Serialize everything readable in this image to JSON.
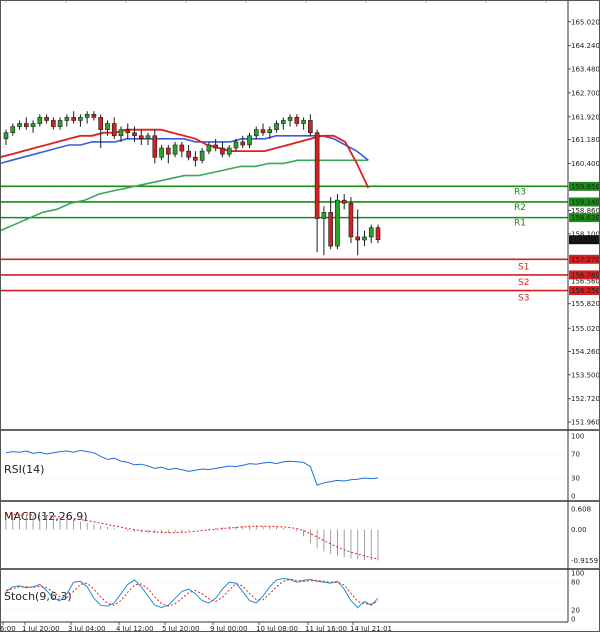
{
  "chart_data": [
    {
      "type": "candlestick",
      "title": "",
      "price_ticks": [
        165.02,
        164.24,
        163.48,
        162.7,
        161.92,
        161.18,
        160.4,
        158.86,
        158.1,
        155.82,
        155.02,
        154.26,
        153.5,
        152.72,
        151.96
      ],
      "x_labels": [
        "6:00",
        "1 Jul 20:00",
        "3 Jul 04:00",
        "4 Jul 12:00",
        "5 Jul 20:00",
        "9 Jul 00:00",
        "10 Jul 08:00",
        "11 Jul 16:00",
        "14 Jul 21:01"
      ],
      "current_price": "157.909",
      "ylim": [
        151.7,
        165.6
      ],
      "levels": [
        {
          "name": "R3",
          "value": 159.65,
          "label": "159.650",
          "color": "#1a8a1a"
        },
        {
          "name": "R2",
          "value": 159.14,
          "label": "159.140",
          "color": "#1a8a1a"
        },
        {
          "name": "R1",
          "value": 158.63,
          "label": "158.630",
          "color": "#1a8a1a"
        },
        {
          "name": "S1",
          "value": 157.27,
          "label": "157.270",
          "color": "#d42020"
        },
        {
          "name": "S2",
          "value": 156.76,
          "label": "156.760",
          "color": "#d42020"
        },
        {
          "name": "S3",
          "value": 156.25,
          "label": "156.250",
          "color": "#d42020"
        }
      ],
      "extra_tick": "156.560",
      "candles": [
        [
          161.2,
          161.5,
          161.0,
          161.4
        ],
        [
          161.4,
          161.7,
          161.3,
          161.6
        ],
        [
          161.6,
          161.8,
          161.5,
          161.7
        ],
        [
          161.7,
          161.9,
          161.5,
          161.6
        ],
        [
          161.6,
          161.8,
          161.4,
          161.7
        ],
        [
          161.7,
          162.0,
          161.6,
          161.9
        ],
        [
          161.9,
          162.0,
          161.7,
          161.8
        ],
        [
          161.8,
          161.9,
          161.5,
          161.6
        ],
        [
          161.6,
          161.9,
          161.5,
          161.8
        ],
        [
          161.8,
          162.0,
          161.6,
          161.9
        ],
        [
          161.9,
          162.1,
          161.7,
          161.8
        ],
        [
          161.8,
          162.0,
          161.6,
          161.9
        ],
        [
          161.9,
          162.1,
          161.7,
          162.0
        ],
        [
          162.0,
          162.1,
          161.8,
          161.9
        ],
        [
          161.9,
          162.0,
          160.9,
          161.5
        ],
        [
          161.5,
          161.8,
          161.3,
          161.7
        ],
        [
          161.7,
          161.9,
          161.2,
          161.3
        ],
        [
          161.3,
          161.6,
          161.1,
          161.5
        ],
        [
          161.5,
          161.7,
          161.2,
          161.4
        ],
        [
          161.4,
          161.6,
          161.1,
          161.3
        ],
        [
          161.3,
          161.5,
          161.0,
          161.2
        ],
        [
          161.2,
          161.4,
          161.0,
          161.3
        ],
        [
          161.3,
          161.5,
          160.4,
          160.6
        ],
        [
          160.6,
          161.0,
          160.5,
          160.9
        ],
        [
          160.9,
          161.0,
          160.4,
          160.7
        ],
        [
          160.7,
          161.1,
          160.6,
          161.0
        ],
        [
          161.0,
          161.1,
          160.6,
          160.8
        ],
        [
          160.8,
          161.0,
          160.5,
          160.6
        ],
        [
          160.6,
          160.8,
          160.3,
          160.5
        ],
        [
          160.5,
          160.9,
          160.4,
          160.8
        ],
        [
          160.8,
          161.1,
          160.7,
          161.0
        ],
        [
          161.0,
          161.2,
          160.8,
          160.9
        ],
        [
          160.9,
          161.1,
          160.6,
          160.7
        ],
        [
          160.7,
          161.0,
          160.6,
          160.9
        ],
        [
          160.9,
          161.2,
          160.8,
          161.1
        ],
        [
          161.1,
          161.3,
          160.9,
          161.0
        ],
        [
          161.0,
          161.4,
          160.9,
          161.3
        ],
        [
          161.3,
          161.6,
          161.2,
          161.5
        ],
        [
          161.5,
          161.7,
          161.3,
          161.4
        ],
        [
          161.4,
          161.6,
          161.2,
          161.5
        ],
        [
          161.5,
          161.8,
          161.4,
          161.7
        ],
        [
          161.7,
          161.9,
          161.5,
          161.8
        ],
        [
          161.8,
          162.0,
          161.6,
          161.9
        ],
        [
          161.9,
          162.0,
          161.6,
          161.7
        ],
        [
          161.7,
          161.9,
          161.5,
          161.8
        ],
        [
          161.8,
          162.0,
          161.3,
          161.4
        ],
        [
          161.4,
          161.5,
          157.5,
          158.6
        ],
        [
          158.6,
          159.0,
          157.4,
          158.8
        ],
        [
          158.8,
          159.3,
          157.6,
          157.7
        ],
        [
          157.7,
          159.4,
          157.6,
          159.2
        ],
        [
          159.2,
          159.4,
          158.9,
          159.1
        ],
        [
          159.1,
          159.3,
          157.8,
          158.0
        ],
        [
          158.0,
          158.9,
          157.4,
          157.9
        ],
        [
          157.9,
          158.2,
          157.7,
          158.0
        ],
        [
          158.0,
          158.4,
          157.8,
          158.3
        ],
        [
          158.3,
          158.4,
          157.8,
          157.909
        ]
      ],
      "ma_red": [
        160.6,
        160.7,
        160.8,
        160.9,
        161.0,
        161.1,
        161.2,
        161.3,
        161.3,
        161.4,
        161.4,
        161.5,
        161.5,
        161.5,
        161.5,
        161.4,
        161.3,
        161.2,
        161.0,
        160.9,
        160.8,
        160.8,
        160.8,
        160.8,
        160.9,
        161.0,
        161.1,
        161.2,
        161.3,
        161.3,
        161.1,
        160.4,
        159.6
      ],
      "ma_blue": [
        160.4,
        160.5,
        160.6,
        160.7,
        160.8,
        160.9,
        161.0,
        161.0,
        161.1,
        161.1,
        161.1,
        161.2,
        161.2,
        161.2,
        161.2,
        161.2,
        161.2,
        161.1,
        161.1,
        161.1,
        161.1,
        161.2,
        161.2,
        161.2,
        161.3,
        161.3,
        161.3,
        161.3,
        161.3,
        161.2,
        161.0,
        160.8,
        160.5
      ],
      "ma_green": [
        158.2,
        158.4,
        158.6,
        158.8,
        158.9,
        159.1,
        159.2,
        159.4,
        159.5,
        159.6,
        159.7,
        159.8,
        159.9,
        160.0,
        160.0,
        160.1,
        160.2,
        160.3,
        160.3,
        160.4,
        160.4,
        160.5,
        160.5,
        160.5,
        160.5,
        160.5,
        160.5
      ]
    },
    {
      "type": "line",
      "name": "RSI(14)",
      "ticks": [
        "100",
        "70",
        "30",
        "0"
      ],
      "tick_values": [
        100,
        70,
        30,
        0
      ],
      "ylim": [
        0,
        100
      ],
      "values": [
        72,
        74,
        73,
        75,
        71,
        73,
        70,
        72,
        74,
        75,
        73,
        76,
        74,
        72,
        66,
        61,
        63,
        58,
        56,
        52,
        53,
        50,
        46,
        48,
        44,
        46,
        44,
        41,
        43,
        45,
        44,
        46,
        48,
        50,
        49,
        51,
        54,
        53,
        55,
        56,
        54,
        57,
        58,
        57,
        56,
        49,
        18,
        22,
        24,
        26,
        25,
        27,
        28,
        30,
        29,
        30
      ]
    },
    {
      "type": "line",
      "name": "MACD(12,26,9)",
      "ticks": [
        "0.608",
        "0.00",
        "-0.9159"
      ],
      "tick_values": [
        0.608,
        0.0,
        -0.9159
      ],
      "ylim": [
        -1.05,
        0.7
      ],
      "histogram": [
        0.45,
        0.45,
        0.44,
        0.43,
        0.42,
        0.41,
        0.4,
        0.38,
        0.35,
        0.32,
        0.28,
        0.24,
        0.2,
        0.16,
        0.12,
        0.08,
        0.04,
        0.0,
        -0.04,
        -0.07,
        -0.09,
        -0.1,
        -0.11,
        -0.11,
        -0.1,
        -0.08,
        -0.06,
        -0.03,
        -0.01,
        0.01,
        0.03,
        0.05,
        0.07,
        0.09,
        0.1,
        0.11,
        0.12,
        0.12,
        0.11,
        0.1,
        0.08,
        0.05,
        0.02,
        -0.05,
        -0.2,
        -0.4,
        -0.55,
        -0.65,
        -0.72,
        -0.78,
        -0.82,
        -0.86,
        -0.88,
        -0.9,
        -0.91,
        -0.9159
      ],
      "signal": [
        0.45,
        0.45,
        0.44,
        0.44,
        0.43,
        0.42,
        0.41,
        0.4,
        0.38,
        0.36,
        0.33,
        0.3,
        0.27,
        0.23,
        0.19,
        0.15,
        0.11,
        0.07,
        0.03,
        0.0,
        -0.03,
        -0.05,
        -0.07,
        -0.08,
        -0.09,
        -0.09,
        -0.08,
        -0.07,
        -0.05,
        -0.03,
        -0.01,
        0.01,
        0.03,
        0.05,
        0.06,
        0.08,
        0.09,
        0.1,
        0.1,
        0.1,
        0.09,
        0.08,
        0.06,
        0.03,
        -0.03,
        -0.12,
        -0.22,
        -0.33,
        -0.43,
        -0.52,
        -0.6,
        -0.67,
        -0.73,
        -0.78,
        -0.83,
        -0.87
      ]
    },
    {
      "type": "line",
      "name": "Stoch(9,6,3)",
      "ticks": [
        "100",
        "80",
        "20",
        "0"
      ],
      "tick_values": [
        100,
        80,
        20,
        0
      ],
      "ylim": [
        0,
        100
      ],
      "k": [
        60,
        70,
        72,
        68,
        70,
        75,
        62,
        45,
        40,
        55,
        80,
        82,
        70,
        45,
        30,
        28,
        35,
        55,
        75,
        85,
        70,
        50,
        30,
        25,
        30,
        45,
        60,
        65,
        55,
        40,
        35,
        45,
        65,
        80,
        78,
        60,
        40,
        35,
        50,
        70,
        85,
        88,
        86,
        80,
        84,
        86,
        82,
        80,
        78,
        82,
        65,
        40,
        25,
        38,
        30,
        45
      ],
      "d": [
        62,
        66,
        70,
        70,
        69,
        71,
        68,
        58,
        48,
        47,
        60,
        75,
        78,
        65,
        48,
        34,
        30,
        40,
        58,
        74,
        76,
        66,
        48,
        33,
        28,
        33,
        45,
        57,
        62,
        55,
        44,
        38,
        47,
        63,
        77,
        72,
        55,
        42,
        42,
        55,
        70,
        82,
        86,
        84,
        82,
        83,
        84,
        82,
        80,
        80,
        74,
        56,
        38,
        34,
        32,
        38
      ]
    }
  ]
}
